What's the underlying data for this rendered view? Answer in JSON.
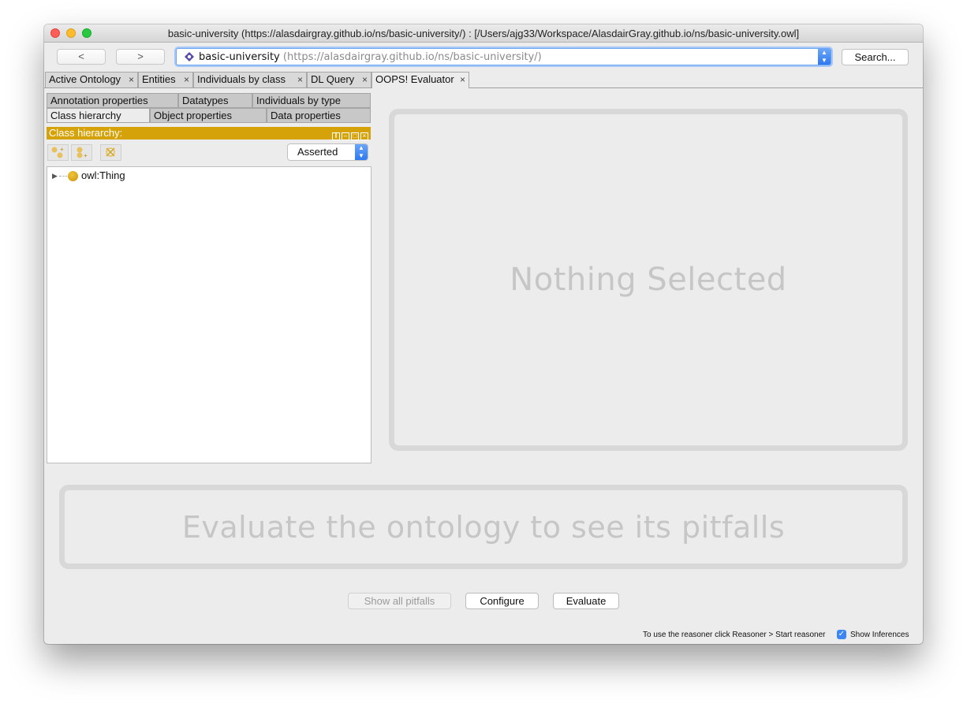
{
  "window": {
    "title": "basic-university (https://alasdairgray.github.io/ns/basic-university/)  : [/Users/ajg33/Workspace/AlasdairGray.github.io/ns/basic-university.owl]"
  },
  "toolbar": {
    "back_label": "<",
    "forward_label": ">",
    "ontology_name": "basic-university",
    "ontology_iri": "(https://alasdairgray.github.io/ns/basic-university/)",
    "search_label": "Search..."
  },
  "tabs": [
    {
      "label": "Active Ontology"
    },
    {
      "label": "Entities"
    },
    {
      "label": "Individuals by class"
    },
    {
      "label": "DL Query"
    },
    {
      "label": "OOPS! Evaluator"
    }
  ],
  "close_glyph": "×",
  "subtabs": {
    "row1": [
      "Annotation properties",
      "Datatypes",
      "Individuals by type"
    ],
    "row2": [
      "Class hierarchy",
      "Object properties",
      "Data properties"
    ]
  },
  "class_hierarchy": {
    "header": "Class hierarchy:",
    "mode": "Asserted",
    "root": "owl:Thing"
  },
  "main": {
    "nothing_selected": "Nothing Selected",
    "pitfalls_placeholder": "Evaluate the ontology to see its pitfalls"
  },
  "buttons": {
    "show_all": "Show all pitfalls",
    "configure": "Configure",
    "evaluate": "Evaluate"
  },
  "status": {
    "reasoner_hint": "To use the reasoner click Reasoner > Start reasoner",
    "show_inferences": "Show Inferences",
    "show_inferences_checked": true
  },
  "colors": {
    "view_header": "#d6a20a",
    "accent": "#3b86f2"
  }
}
